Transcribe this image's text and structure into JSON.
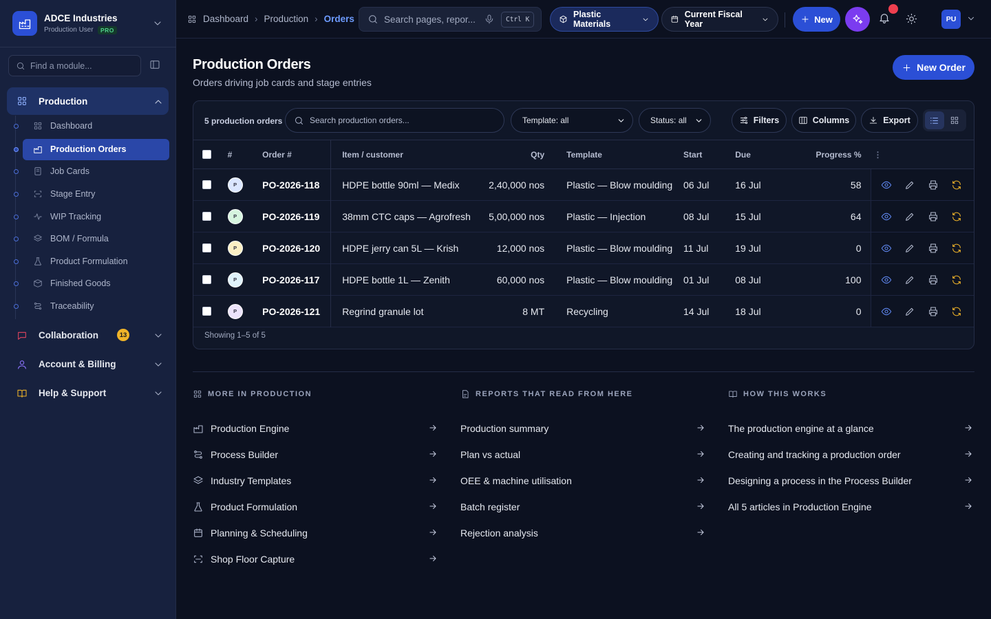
{
  "brand": {
    "name": "ADCE Industries",
    "role": "Production User",
    "plan": "PRO"
  },
  "sidebar": {
    "search_placeholder": "Find a module...",
    "production": {
      "label": "Production",
      "items": [
        {
          "label": "Dashboard",
          "icon": "grid-icon"
        },
        {
          "label": "Production Orders",
          "icon": "factory-icon",
          "active": true
        },
        {
          "label": "Job Cards",
          "icon": "card-icon"
        },
        {
          "label": "Stage Entry",
          "icon": "scan-icon"
        },
        {
          "label": "WIP Tracking",
          "icon": "activity-icon"
        },
        {
          "label": "BOM / Formula",
          "icon": "layers-icon"
        },
        {
          "label": "Product Formulation",
          "icon": "flask-icon"
        },
        {
          "label": "Finished Goods",
          "icon": "box-icon"
        },
        {
          "label": "Traceability",
          "icon": "route-icon"
        }
      ]
    },
    "groups": [
      {
        "label": "Collaboration",
        "badge": "13",
        "color": "#d6345a"
      },
      {
        "label": "Account & Billing",
        "color": "#7c5cff"
      },
      {
        "label": "Help & Support",
        "color": "#f0b429"
      }
    ]
  },
  "topbar": {
    "breadcrumb": [
      "Dashboard",
      "Production",
      "Orders"
    ],
    "search_placeholder": "Search pages, repor...",
    "shortcut": "Ctrl K",
    "material": "Plastic Materials",
    "period": "Current Fiscal Year",
    "new_label": "New",
    "avatar": "PU"
  },
  "page": {
    "title": "Production Orders",
    "subtitle": "Orders driving job cards and stage entries",
    "new_order": "New Order"
  },
  "table": {
    "count_label": "5 production orders",
    "search_placeholder": "Search production orders...",
    "template_filter": "Template: all",
    "status_filter": "Status: all",
    "filters_label": "Filters",
    "columns_label": "Columns",
    "export_label": "Export",
    "headers": {
      "hash": "#",
      "order": "Order #",
      "item": "Item / customer",
      "qty": "Qty",
      "template": "Template",
      "start": "Start",
      "due": "Due",
      "progress": "Progress %"
    },
    "rows": [
      {
        "initial": "P",
        "color": "#dbe6ff",
        "order": "PO-2026-118",
        "item": "HDPE bottle 90ml — Medix",
        "qty": "2,40,000 nos",
        "template": "Plastic — Blow moulding",
        "start": "06 Jul",
        "due": "16 Jul",
        "progress": "58"
      },
      {
        "initial": "P",
        "color": "#d6f5df",
        "order": "PO-2026-119",
        "item": "38mm CTC caps — Agrofresh",
        "qty": "5,00,000 nos",
        "template": "Plastic — Injection",
        "start": "08 Jul",
        "due": "15 Jul",
        "progress": "64"
      },
      {
        "initial": "P",
        "color": "#fbefc4",
        "order": "PO-2026-120",
        "item": "HDPE jerry can 5L — Krish",
        "qty": "12,000 nos",
        "template": "Plastic — Blow moulding",
        "start": "11 Jul",
        "due": "19 Jul",
        "progress": "0"
      },
      {
        "initial": "P",
        "color": "#dff2fb",
        "order": "PO-2026-117",
        "item": "HDPE bottle 1L — Zenith",
        "qty": "60,000 nos",
        "template": "Plastic — Blow moulding",
        "start": "01 Jul",
        "due": "08 Jul",
        "progress": "100"
      },
      {
        "initial": "P",
        "color": "#ece3fb",
        "order": "PO-2026-121",
        "item": "Regrind granule lot",
        "qty": "8 MT",
        "template": "Recycling",
        "start": "14 Jul",
        "due": "18 Jul",
        "progress": "0"
      }
    ],
    "footer": "Showing 1–5 of 5"
  },
  "more": {
    "title": "MORE IN PRODUCTION",
    "items": [
      "Production Engine",
      "Process Builder",
      "Industry Templates",
      "Product Formulation",
      "Planning & Scheduling",
      "Shop Floor Capture"
    ]
  },
  "reports": {
    "title": "REPORTS THAT READ FROM HERE",
    "items": [
      "Production summary",
      "Plan vs actual",
      "OEE & machine utilisation",
      "Batch register",
      "Rejection analysis"
    ]
  },
  "how": {
    "title": "HOW THIS WORKS",
    "items": [
      "The production engine at a glance",
      "Creating and tracking a production order",
      "Designing a process in the Process Builder",
      "All 5 articles in Production Engine"
    ]
  }
}
